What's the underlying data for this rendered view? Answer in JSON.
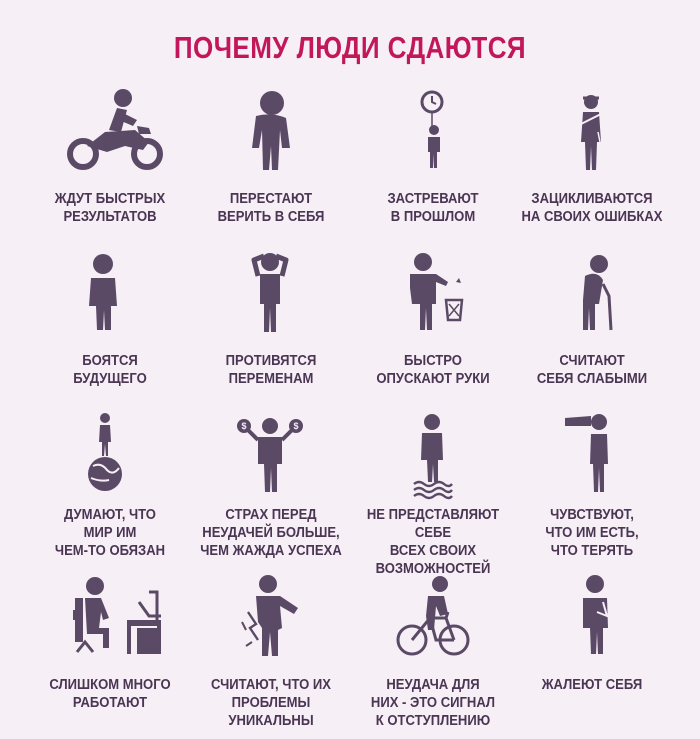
{
  "title": "ПОЧЕМУ ЛЮДИ СДАЮТСЯ",
  "colors": {
    "title": "#c2185b",
    "icon": "#5b4a66",
    "text": "#4a3553",
    "background": "#f6eff6"
  },
  "items": [
    {
      "icon": "motorcycle-rider-icon",
      "lines": [
        "ЖДУТ БЫСТРЫХ",
        "РЕЗУЛЬТАТОВ"
      ]
    },
    {
      "icon": "slumped-person-icon",
      "lines": [
        "ПЕРЕСТАЮТ",
        "ВЕРИТЬ В СЕБЯ"
      ]
    },
    {
      "icon": "person-with-clock-balloon-icon",
      "lines": [
        "ЗАСТРЕВАЮТ",
        "В ПРОШЛОМ"
      ]
    },
    {
      "icon": "injured-person-icon",
      "lines": [
        "ЗАЦИКЛИВАЮТСЯ",
        "НА СВОИХ ОШИБКАХ"
      ]
    },
    {
      "icon": "timid-person-icon",
      "lines": [
        "БОЯТСЯ",
        "БУДУЩЕГО"
      ]
    },
    {
      "icon": "person-holding-head-icon",
      "lines": [
        "ПРОТИВЯТСЯ",
        "ПЕРЕМЕНАМ"
      ]
    },
    {
      "icon": "person-throwing-trash-icon",
      "lines": [
        "БЫСТРО",
        "ОПУСКАЮТ РУКИ"
      ]
    },
    {
      "icon": "elderly-person-cane-icon",
      "lines": [
        "СЧИТАЮТ",
        "СЕБЯ СЛАБЫМИ"
      ]
    },
    {
      "icon": "person-on-globe-icon",
      "lines": [
        "ДУМАЮТ, ЧТО",
        "МИР ИМ",
        "ЧЕМ-ТО ОБЯЗАН"
      ]
    },
    {
      "icon": "person-with-money-bags-icon",
      "lines": [
        "СТРАХ ПЕРЕД",
        "НЕУДАЧЕЙ БОЛЬШЕ,",
        "ЧЕМ ЖАЖДА УСПЕХА"
      ]
    },
    {
      "icon": "person-on-waves-icon",
      "lines": [
        "НЕ ПРЕДСТАВЛЯЮТ СЕБЕ",
        "ВСЕХ СВОИХ",
        "ВОЗМОЖНОСТЕЙ"
      ]
    },
    {
      "icon": "person-with-telescope-icon",
      "lines": [
        "ЧУВСТВУЮТ,",
        "ЧТО ИМ ЕСТЬ,",
        "ЧТО ТЕРЯТЬ"
      ]
    },
    {
      "icon": "person-at-desk-icon",
      "lines": [
        "СЛИШКОМ МНОГО",
        "РАБОТАЮТ"
      ]
    },
    {
      "icon": "person-in-pain-icon",
      "lines": [
        "СЧИТАЮТ, ЧТО ИХ",
        "ПРОБЛЕМЫ",
        "УНИКАЛЬНЫ"
      ]
    },
    {
      "icon": "cyclist-icon",
      "lines": [
        "НЕУДАЧА ДЛЯ",
        "НИХ - ЭТО СИГНАЛ",
        "К ОТСТУПЛЕНИЮ"
      ]
    },
    {
      "icon": "sad-person-icon",
      "lines": [
        "ЖАЛЕЮТ СЕБЯ"
      ]
    }
  ]
}
